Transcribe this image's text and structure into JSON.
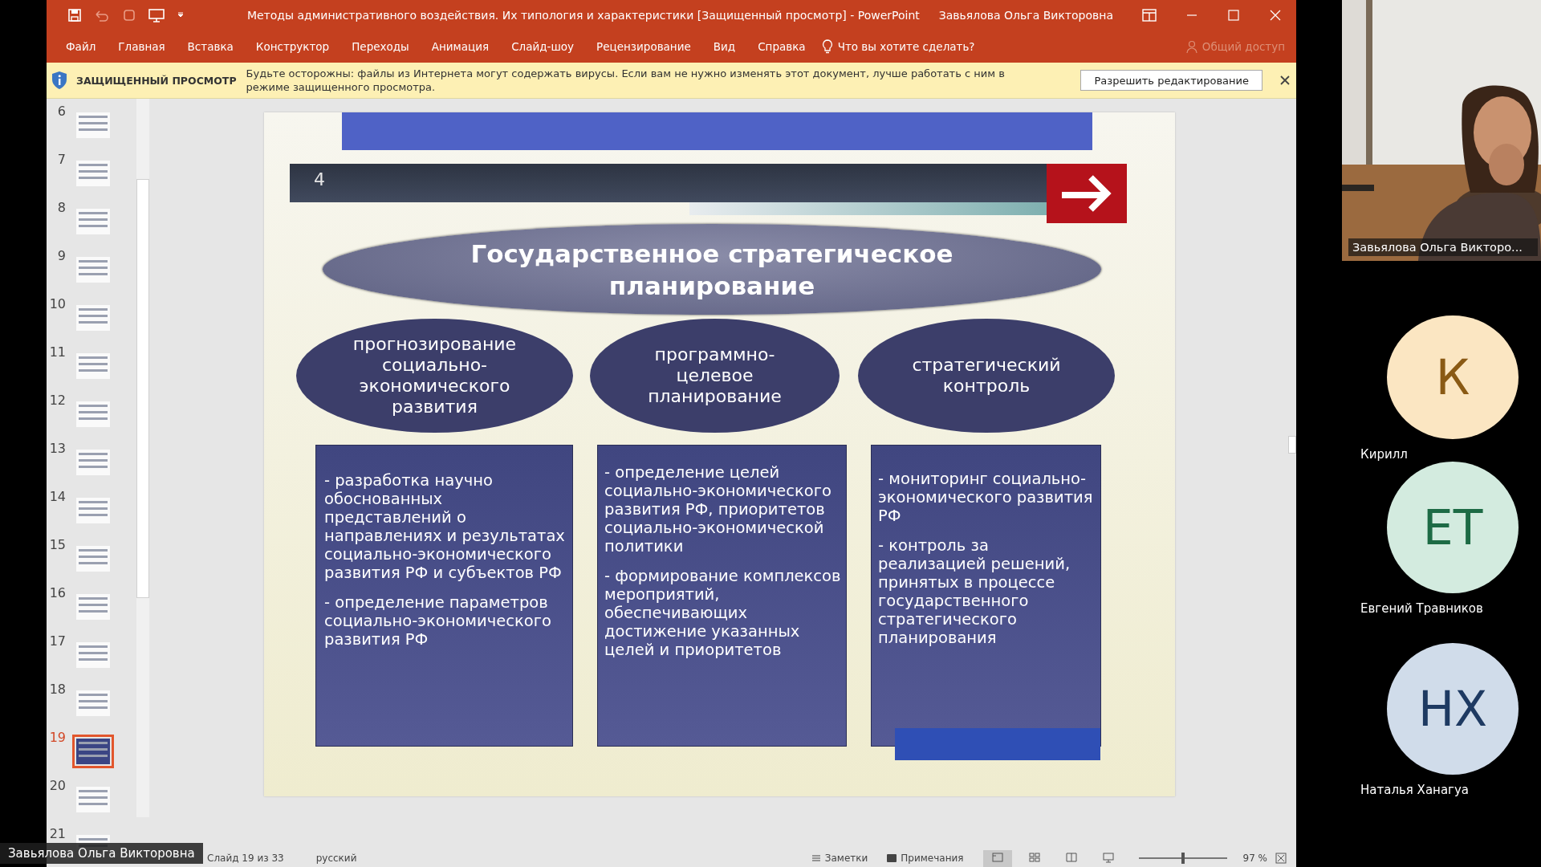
{
  "window": {
    "title": "Методы административного воздействия. Их типология и характеристики [Защищенный просмотр]  -  PowerPoint",
    "user": "Завьялова Ольга Викторовна"
  },
  "ribbon_tabs": [
    {
      "label": "Файл"
    },
    {
      "label": "Главная"
    },
    {
      "label": "Вставка"
    },
    {
      "label": "Конструктор"
    },
    {
      "label": "Переходы"
    },
    {
      "label": "Анимация"
    },
    {
      "label": "Слайд-шоу"
    },
    {
      "label": "Рецензирование"
    },
    {
      "label": "Вид"
    },
    {
      "label": "Справка"
    }
  ],
  "tell_me": "Что вы хотите сделать?",
  "share": {
    "label": "Общий доступ",
    "disabled": true
  },
  "protected_view": {
    "title": "ЗАЩИЩЕННЫЙ ПРОСМОТР",
    "message": "Будьте осторожны: файлы из Интернета могут содержать вирусы. Если вам не нужно изменять этот документ, лучше работать с ним в режиме защищенного просмотра.",
    "button": "Разрешить редактирование"
  },
  "thumbnails": [
    {
      "number": "6",
      "selected": false
    },
    {
      "number": "7",
      "selected": false
    },
    {
      "number": "8",
      "selected": false
    },
    {
      "number": "9",
      "selected": false
    },
    {
      "number": "10",
      "selected": false
    },
    {
      "number": "11",
      "selected": false
    },
    {
      "number": "12",
      "selected": false
    },
    {
      "number": "13",
      "selected": false
    },
    {
      "number": "14",
      "selected": false
    },
    {
      "number": "15",
      "selected": false
    },
    {
      "number": "16",
      "selected": false
    },
    {
      "number": "17",
      "selected": false
    },
    {
      "number": "18",
      "selected": false
    },
    {
      "number": "19",
      "selected": true
    },
    {
      "number": "20",
      "selected": false
    },
    {
      "number": "21",
      "selected": false
    }
  ],
  "slide": {
    "number": "4",
    "title": "Государственное стратегическое планирование",
    "columns": [
      {
        "heading": "прогнозирование социально-экономического развития",
        "points": [
          "- разработка научно обоснованных представлений о направлениях и результатах социально-экономического развития РФ и субъектов РФ",
          "- определение параметров социально-экономического развития РФ"
        ]
      },
      {
        "heading": "программно-целевое планирование",
        "points": [
          "- определение целей социально-экономического развития РФ, приоритетов социально-экономической политики",
          "- формирование комплексов мероприятий, обеспечивающих достижение указанных целей и приоритетов"
        ]
      },
      {
        "heading": "стратегический контроль",
        "points": [
          "- мониторинг социально-экономического развития РФ",
          "- контроль за реализацией решений, принятых в процессе государственного стратегического планирования"
        ]
      }
    ]
  },
  "status_bar": {
    "slide_counter": "Слайд 19 из 33",
    "language": "русский",
    "notes": "Заметки",
    "comments": "Примечания",
    "view_buttons": [
      {
        "selected": true
      },
      {
        "selected": false
      },
      {
        "selected": false
      },
      {
        "selected": false
      }
    ],
    "zoom_slider": {
      "level": 0.5
    },
    "zoom": "97 %"
  },
  "presenter_label": "Завьялова Ольга Викторовна",
  "video_tile": {
    "kind": "picture",
    "name": "Завьялова Ольга Викторо..."
  },
  "participants": [
    {
      "initials": "К",
      "name": "Кирилл",
      "color": "#fbe6c2"
    },
    {
      "initials": "ЕТ",
      "name": "Евгений Травников",
      "color": "#d3ebdf"
    },
    {
      "initials": "НХ",
      "name": "Наталья Ханагуа",
      "color": "#d0dcea"
    }
  ]
}
